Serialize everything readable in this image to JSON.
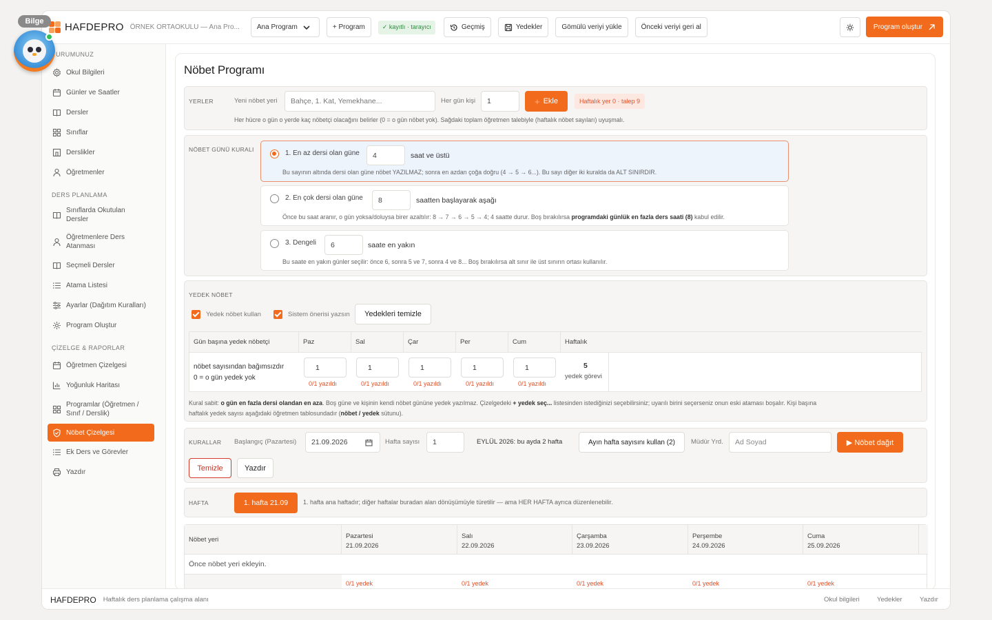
{
  "mascot": {
    "badge": "Bilge"
  },
  "topbar": {
    "brand": "HAFDEPRO",
    "school": "ÖRNEK ORTAOKULU — Ana Pro...",
    "program_select": "Ana Program",
    "new_program": "+ Program",
    "status_chip": "✓ kayıtlı · tarayıcı",
    "history": "Geçmiş",
    "backups": "Yedekler",
    "load_embedded": "Gömülü veriyi yükle",
    "restore": "Önceki veriyi geri al",
    "create": "Program oluştur",
    "accent": "#f26a1b"
  },
  "sidebar": {
    "sec1": "URUMUNUZ",
    "items1": [
      {
        "label": "Okul Bilgileri",
        "icon": "settings-icon"
      },
      {
        "label": "Günler ve Saatler",
        "icon": "calendar-icon"
      },
      {
        "label": "Dersler",
        "icon": "book-icon"
      },
      {
        "label": "Sınıflar",
        "icon": "grid-icon"
      },
      {
        "label": "Derslikler",
        "icon": "room-icon"
      },
      {
        "label": "Öğretmenler",
        "icon": "person-icon"
      }
    ],
    "sec2": "DERS PLANLAMA",
    "items2": [
      {
        "label": "Sınıflarda Okutulan Dersler",
        "icon": "book-icon"
      },
      {
        "label": "Öğretmenlere Ders Atanması",
        "icon": "person-icon"
      },
      {
        "label": "Seçmeli Dersler",
        "icon": "book-icon"
      },
      {
        "label": "Atama Listesi",
        "icon": "list-icon"
      },
      {
        "label": "Ayarlar (Dağıtım Kuralları)",
        "icon": "sliders-icon"
      },
      {
        "label": "Program Oluştur",
        "icon": "gear-icon"
      }
    ],
    "sec3": "ÇİZELGE & RAPORLAR",
    "items3": [
      {
        "label": "Öğretmen Çizelgesi",
        "icon": "calendar-icon"
      },
      {
        "label": "Yoğunluk Haritası",
        "icon": "chart-icon"
      },
      {
        "label": "Programlar (Öğretmen / Sınıf / Derslik)",
        "icon": "grid-icon"
      },
      {
        "label": "Nöbet Çizelgesi",
        "icon": "shield-check-icon",
        "active": true
      },
      {
        "label": "Ek Ders ve Görevler",
        "icon": "list-icon"
      },
      {
        "label": "Yazdır",
        "icon": "printer-icon"
      }
    ]
  },
  "main": {
    "title": "Nöbet Programı",
    "places": {
      "label": "YERLER",
      "new_label": "Yeni nöbet yeri",
      "new_placeholder": "Bahçe, 1. Kat, Yemekhane...",
      "daily_label": "Her gün kişi",
      "daily_value": "1",
      "add": "Ekle",
      "weekly_chip": "Haftalık yer 0 · talep 9",
      "help": "Her hücre o gün o yerde kaç nöbetçi olacağını belirler (0 = o gün nöbet yok). Sağdaki toplam öğretmen talebiyle (haftalık nöbet sayıları) uyuşmalı."
    },
    "rule": {
      "label": "NÖBET GÜNÜ KURALI",
      "options": [
        {
          "title": "1. En az dersi olan güne",
          "value": "4",
          "suffix": "saat ve üstü",
          "desc": "Bu sayının altında dersi olan güne nöbet YAZILMAZ; sonra en azdan çoğa doğru (4 → 5 → 6...). Bu sayı diğer iki kuralda da ALT SINIRDIR.",
          "selected": true
        },
        {
          "title": "2. En çok dersi olan güne",
          "value": "8",
          "suffix": "saatten başlayarak aşağı",
          "desc_a": "Önce bu saat aranır, o gün yoksa/doluysa birer azaltılır: 8 → 7 → 6 → 5 → 4; 4 saatte durur. Boş bırakılırsa ",
          "desc_b": "programdaki günlük en fazla ders saati (8)",
          "desc_c": " kabul edilir.",
          "selected": false
        },
        {
          "title": "3. Dengeli",
          "value": "6",
          "suffix": "saate en yakın",
          "desc": "Bu saate en yakın günler seçilir: önce 6, sonra 5 ve 7, sonra 4 ve 8... Boş bırakılırsa alt sınır ile üst sınırın ortası kullanılır.",
          "selected": false
        }
      ]
    },
    "backup": {
      "label": "YEDEK NÖBET",
      "use_backup": "Yedek nöbet kullan",
      "system_suggest": "Sistem önerisi yazsın",
      "clear": "Yedekleri temizle",
      "headers": [
        "Gün başına yedek nöbetçi",
        "Paz",
        "Sal",
        "Çar",
        "Per",
        "Cum",
        "Haftalık"
      ],
      "row_label_1": "nöbet sayısından bağımsızdır",
      "row_label_2": "0 = o gün yedek yok",
      "values": [
        "1",
        "1",
        "1",
        "1",
        "1"
      ],
      "statuses": [
        "0/1 yazıldı",
        "0/1 yazıldı",
        "0/1 yazıldı",
        "0/1 yazıldı",
        "0/1 yazıldı"
      ],
      "weekly_value": "5",
      "weekly_text": "yedek görevi",
      "note_1": "Kural sabit: ",
      "note_2": "o gün en fazla dersi olandan en aza",
      "note_3": ". Boş güne ve kişinin kendi nöbet gününe yedek yazılmaz. Çizelgedeki ",
      "note_4": "+ yedek seç...",
      "note_5": " listesinden istediğinizi seçebilirsiniz; uyarılı birini seçerseniz onun eski ataması boşalır. Kişi başına",
      "note_6": "haftalık yedek sayısı aşağıdaki öğretmen tablosundadır (",
      "note_7": "nöbet / yedek",
      "note_8": " sütunu)."
    },
    "rules": {
      "label": "KURALLAR",
      "start_label": "Başlangıç (Pazartesi)",
      "start_value": "21.09.2026",
      "weeks_label": "Hafta sayısı",
      "weeks_value": "1",
      "month_info": "EYLÜL 2026: bu ayda 2 hafta",
      "use_month": "Ayın hafta sayısını kullan (2)",
      "deputy_label": "Müdür Yrd.",
      "deputy_placeholder": "Ad Soyad",
      "distribute": "▶ Nöbet dağıt",
      "clear": "Temizle",
      "print": "Yazdır"
    },
    "week": {
      "label": "HAFTA",
      "chip": "1. hafta  21.09",
      "info": "1. hafta ana haftadır; diğer haftalar buradan alan dönüşümüyle türetilir — ama HER HAFTA ayrıca düzenlenebilir."
    },
    "schedule": {
      "place_header": "Nöbet yeri",
      "days": [
        {
          "name": "Pazartesi",
          "date": "21.09.2026",
          "backup": "0/1 yedek"
        },
        {
          "name": "Salı",
          "date": "22.09.2026",
          "backup": "0/1 yedek"
        },
        {
          "name": "Çarşamba",
          "date": "23.09.2026",
          "backup": "0/1 yedek"
        },
        {
          "name": "Perşembe",
          "date": "24.09.2026",
          "backup": "0/1 yedek"
        },
        {
          "name": "Cuma",
          "date": "25.09.2026",
          "backup": "0/1 yedek"
        }
      ],
      "empty": "Önce nöbet yeri ekleyin."
    }
  },
  "footer": {
    "brand": "HAFDEPRO",
    "subtitle": "Haftalık ders planlama çalışma alanı",
    "links": [
      "Okul bilgileri",
      "Yedekler",
      "Yazdır"
    ]
  }
}
